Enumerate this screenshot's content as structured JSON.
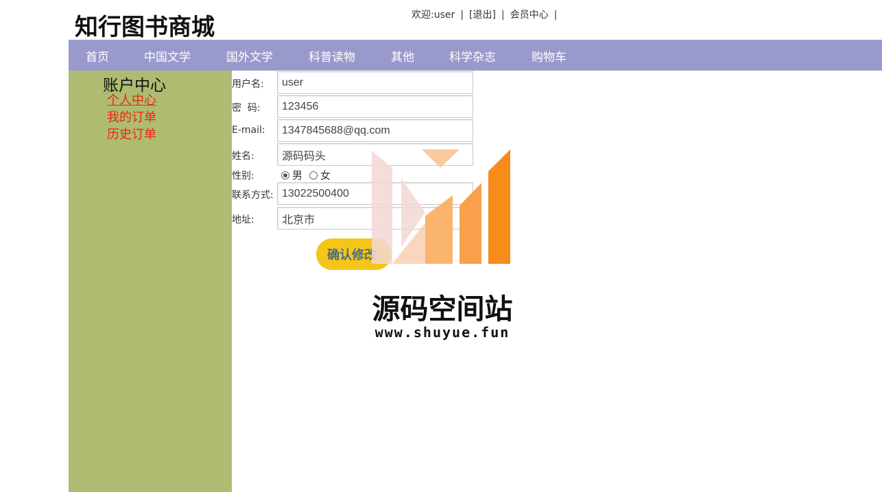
{
  "logo": "知行图书商城",
  "topbar": {
    "welcome": "欢迎:user",
    "logout": "[退出]",
    "member_center": "会员中心"
  },
  "nav": [
    "首页",
    "中国文学",
    "国外文学",
    "科普读物",
    "其他",
    "科学杂志",
    "购物车"
  ],
  "sidebar": {
    "title": "账户中心",
    "links": [
      "个人中心",
      "我的订单",
      "历史订单"
    ]
  },
  "form": {
    "username_label": "用户名:",
    "username_value": "user",
    "password_label": "密  码:",
    "password_value": "123456",
    "email_label": "E-mail:",
    "email_value": "1347845688@qq.com",
    "name_label": "姓名:",
    "name_value": "源码码头",
    "gender_label": "性别:",
    "gender_male": "男",
    "gender_female": "女",
    "gender_selected": "男",
    "phone_label": "联系方式:",
    "phone_value": "13022500400",
    "address_label": "地址:",
    "address_value": "北京市",
    "submit_label": "确认修改"
  },
  "watermark": {
    "title": "源码空间站",
    "url": "www.shuyue.fun"
  },
  "colors": {
    "nav_bg": "#9999cc",
    "sidebar_bg": "#adbc70",
    "link_red": "#e8260f",
    "button_yellow": "#f5c518"
  }
}
